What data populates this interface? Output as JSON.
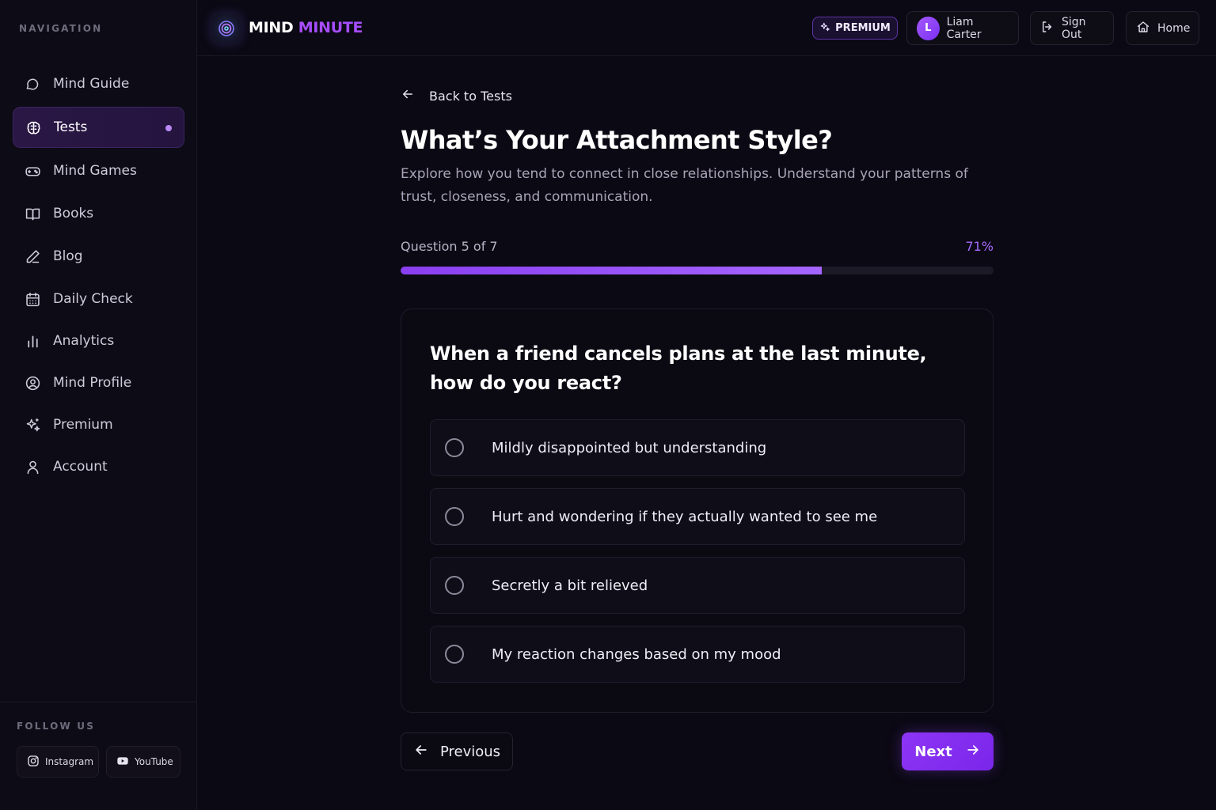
{
  "sidebar": {
    "heading": "NAVIGATION",
    "items": [
      {
        "label": "Mind Guide",
        "icon": "chat-bubble-icon"
      },
      {
        "label": "Tests",
        "icon": "brain-icon",
        "active": true
      },
      {
        "label": "Mind Games",
        "icon": "gamepad-icon"
      },
      {
        "label": "Books",
        "icon": "book-icon"
      },
      {
        "label": "Blog",
        "icon": "pen-icon"
      },
      {
        "label": "Daily Check",
        "icon": "calendar-icon"
      },
      {
        "label": "Analytics",
        "icon": "bar-chart-icon"
      },
      {
        "label": "Mind Profile",
        "icon": "user-circle-icon"
      },
      {
        "label": "Premium",
        "icon": "sparkles-icon"
      },
      {
        "label": "Account",
        "icon": "user-icon"
      }
    ],
    "follow_heading": "FOLLOW US",
    "social": [
      {
        "label": "Instagram",
        "icon": "instagram-icon"
      },
      {
        "label": "YouTube",
        "icon": "youtube-icon"
      }
    ]
  },
  "header": {
    "logo_part1": "MIND",
    "logo_part2": "MINUTE",
    "premium_label": "PREMIUM",
    "user_initial": "L",
    "user_name": "Liam Carter",
    "signout_label": "Sign Out",
    "home_label": "Home"
  },
  "main": {
    "back_label": "Back to Tests",
    "title": "What’s Your Attachment Style?",
    "description": "Explore how you tend to connect in close relationships. Understand your patterns of trust, closeness, and communication.",
    "question_counter": "Question 5 of 7",
    "progress_label": "71%",
    "progress_value": 0.71,
    "question": "When a friend cancels plans at the last minute, how do you react?",
    "options": [
      "Mildly disappointed but understanding",
      "Hurt and wondering if they actually wanted to see me",
      "Secretly a bit relieved",
      "My reaction changes based on my mood"
    ],
    "prev_label": "Previous",
    "next_label": "Next"
  },
  "colors": {
    "accent": "#8d35f5",
    "accent_text": "#a66bff",
    "background": "#0b0913"
  }
}
